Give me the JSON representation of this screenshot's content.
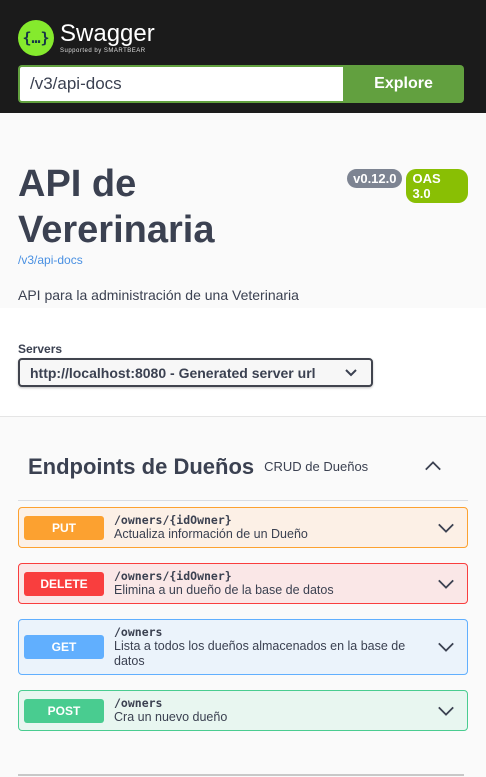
{
  "header": {
    "logo_icon": "{…}",
    "logo_title": "Swagger",
    "logo_sub": "Supported by SMARTBEAR",
    "search_value": "/v3/api-docs",
    "explore_label": "Explore"
  },
  "info": {
    "title": "API de Vererinaria",
    "version_badge": "v0.12.0",
    "oas_badge": "OAS 3.0",
    "url": "/v3/api-docs",
    "description": "API para la administración de una Veterinaria"
  },
  "servers": {
    "label": "Servers",
    "selected": "http://localhost:8080 - Generated server url"
  },
  "tag": {
    "name": "Endpoints de Dueños",
    "description": "CRUD de Dueños"
  },
  "operations": [
    {
      "method": "PUT",
      "path": "/owners/{idOwner}",
      "summary": "Actualiza información de un Dueño"
    },
    {
      "method": "DELETE",
      "path": "/owners/{idOwner}",
      "summary": "Elimina a un dueño de la base de datos"
    },
    {
      "method": "GET",
      "path": "/owners",
      "summary": "Lista a todos los dueños almacenados en la base de datos"
    },
    {
      "method": "POST",
      "path": "/owners",
      "summary": "Cra un nuevo dueño"
    }
  ],
  "colors": {
    "put": "#fca130",
    "delete": "#f93e3e",
    "get": "#61affe",
    "post": "#49cc90",
    "explore": "#62a03f",
    "logo": "#85ea2d"
  }
}
